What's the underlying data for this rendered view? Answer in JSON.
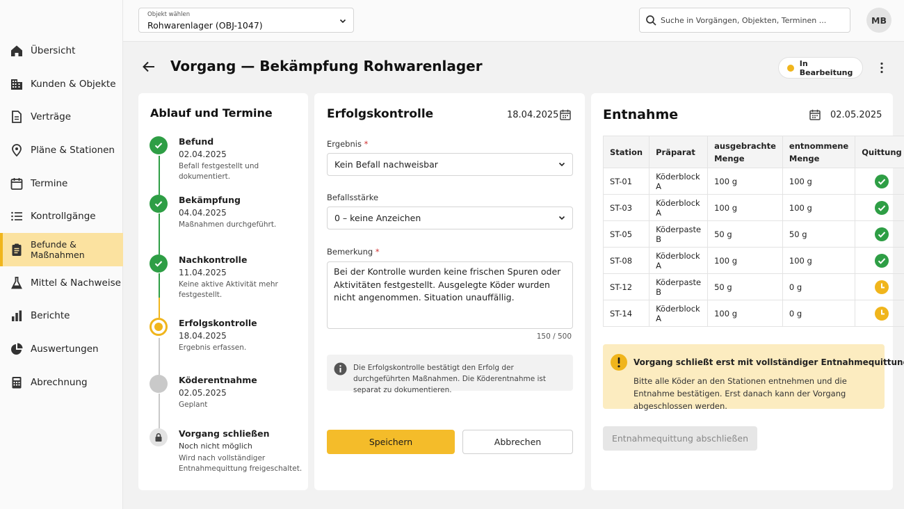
{
  "nav": {
    "items": [
      {
        "label": "Übersicht",
        "icon": "home-icon"
      },
      {
        "label": "Kunden & Objekte",
        "icon": "building-icon"
      },
      {
        "label": "Verträge",
        "icon": "document-icon"
      },
      {
        "label": "Pläne & Stationen",
        "icon": "map-pin-icon"
      },
      {
        "label": "Termine",
        "icon": "calendar-icon"
      },
      {
        "label": "Kontrollgänge",
        "icon": "list-icon"
      },
      {
        "label": "Befunde & Maßnahmen",
        "icon": "clipboard-icon",
        "active": true
      },
      {
        "label": "Mittel & Nachweise",
        "icon": "flask-icon"
      },
      {
        "label": "Berichte",
        "icon": "bar-chart-icon"
      },
      {
        "label": "Auswertungen",
        "icon": "pie-chart-icon"
      },
      {
        "label": "Abrechnung",
        "icon": "calculator-icon"
      }
    ]
  },
  "topbar": {
    "object_label": "Objekt wählen",
    "object_value": "Rohwarenlager (OBJ-1047)",
    "search_placeholder": "Suche in Vorgängen, Objekten, Terminen ...",
    "avatar": "MB"
  },
  "header": {
    "title": "Vorgang — Bekämpfung Rohwarenlager",
    "status": "In Bearbeitung",
    "status_color": "#f0b51c"
  },
  "timeline": {
    "title": "Ablauf und Termine",
    "steps": [
      {
        "title": "Befund",
        "date": "02.04.2025",
        "note": "Befall festgestellt und dokumentiert.",
        "state": "done"
      },
      {
        "title": "Bekämpfung",
        "date": "04.04.2025",
        "note": "Maßnahmen durchgeführt.",
        "state": "done"
      },
      {
        "title": "Nachkontrolle",
        "date": "11.04.2025",
        "note": "Keine aktive Aktivität mehr festgestellt.",
        "state": "done"
      },
      {
        "title": "Erfolgskontrolle",
        "date": "18.04.2025",
        "note": "Ergebnis erfassen.",
        "state": "current"
      },
      {
        "title": "Köderentnahme",
        "date": "02.05.2025",
        "note": "Geplant",
        "state": "planned"
      },
      {
        "title": "Vorgang schließen",
        "date": "Noch nicht möglich",
        "note": "Wird nach vollständiger Entnahmequittung freigeschaltet.",
        "state": "locked"
      }
    ]
  },
  "erfolg": {
    "title": "Erfolgskontrolle",
    "date": "18.04.2025",
    "ergebnis_label": "Ergebnis",
    "ergebnis_value": "Kein Befall nachweisbar",
    "staerke_label": "Befallsstärke",
    "staerke_value": "0 – keine Anzeichen",
    "bemerkung_label": "Bemerkung",
    "bemerkung_value": "Bei der Kontrolle wurden keine frischen Spuren oder Aktivitäten festgestellt. Ausgelegte Köder wurden nicht angenommen. Situation unauffällig.",
    "required_mark": "*",
    "counter": "150 / 500",
    "info": "Die Erfolgskontrolle bestätigt den Erfolg der durchgeführten Maßnahmen. Die Köderentnahme ist separat zu dokumentieren.",
    "save": "Speichern",
    "cancel": "Abbrechen"
  },
  "entnahme": {
    "title": "Entnahme",
    "date": "02.05.2025",
    "columns": [
      "Station",
      "Präparat",
      "ausgebrachte Menge",
      "entnommene Menge",
      "Quittung"
    ],
    "rows": [
      {
        "station": "ST-01",
        "praeparat": "Köderblock A",
        "ausgebracht": "100 g",
        "entnommen": "100 g",
        "quittung": "done"
      },
      {
        "station": "ST-03",
        "praeparat": "Köderblock A",
        "ausgebracht": "100 g",
        "entnommen": "100 g",
        "quittung": "done"
      },
      {
        "station": "ST-05",
        "praeparat": "Köderpaste B",
        "ausgebracht": "50 g",
        "entnommen": "50 g",
        "quittung": "done"
      },
      {
        "station": "ST-08",
        "praeparat": "Köderblock A",
        "ausgebracht": "100 g",
        "entnommen": "100 g",
        "quittung": "done"
      },
      {
        "station": "ST-12",
        "praeparat": "Köderpaste B",
        "ausgebracht": "50 g",
        "entnommen": "0 g",
        "quittung": "pending"
      },
      {
        "station": "ST-14",
        "praeparat": "Köderblock A",
        "ausgebracht": "100 g",
        "entnommen": "0 g",
        "quittung": "pending"
      }
    ],
    "warning_title": "Vorgang schließt erst mit vollständiger Entnahmequittung.",
    "warning_text": "Bitte alle Köder an den Stationen entnehmen und die Entnahme bestätigen. Erst danach kann der Vorgang abgeschlossen werden.",
    "button": "Entnahmequittung abschließen"
  },
  "colors": {
    "accent": "#f4bc2a",
    "success": "#2e9e45",
    "pending": "#f0b51c",
    "planned": "#c9c9c9"
  }
}
